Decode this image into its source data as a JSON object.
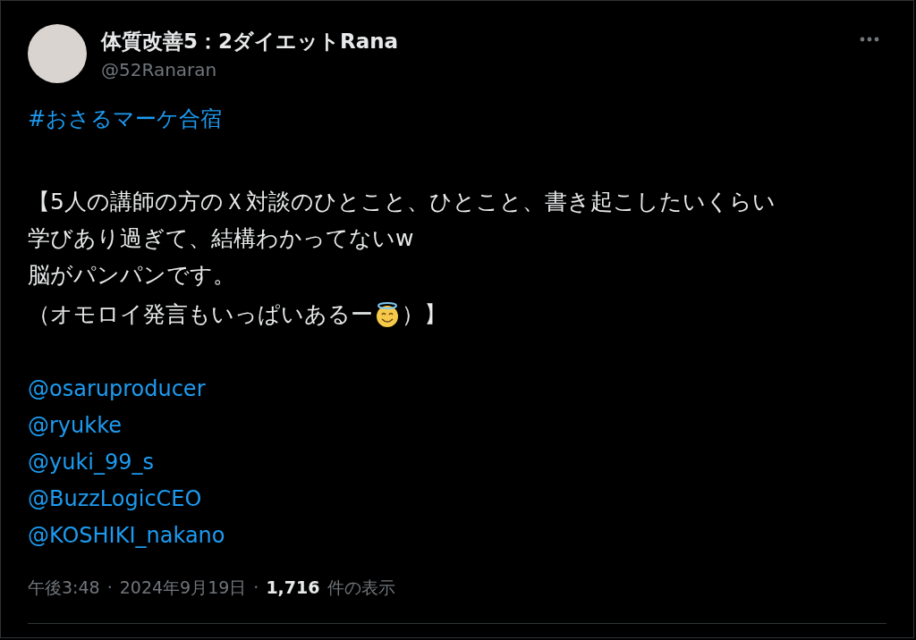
{
  "author": {
    "name": "体質改善5：2ダイエットRana",
    "handle": "@52Ranaran"
  },
  "hashtag": "#おさるマーケ合宿",
  "body_lines": [
    {
      "text": "【5人の講師の方のＸ対談のひとこと、ひとこと、書き起こしたいくらい"
    },
    {
      "text": "学びあり過ぎて、結構わかってないw"
    },
    {
      "text": "脳がパンパンです。"
    },
    {
      "text": "（オモロイ発言もいっぱいあるー",
      "halo_emoji": true,
      "text_after": "）】"
    }
  ],
  "mentions": [
    "@osaruproducer",
    "@ryukke",
    "@yuki_99_s",
    "@BuzzLogicCEO",
    "@KOSHIKI_nakano"
  ],
  "footer": {
    "time": "午後3:48",
    "separator": "·",
    "date": "2024年9月19日",
    "views_count": "1,716",
    "views_label": "件の表示"
  }
}
